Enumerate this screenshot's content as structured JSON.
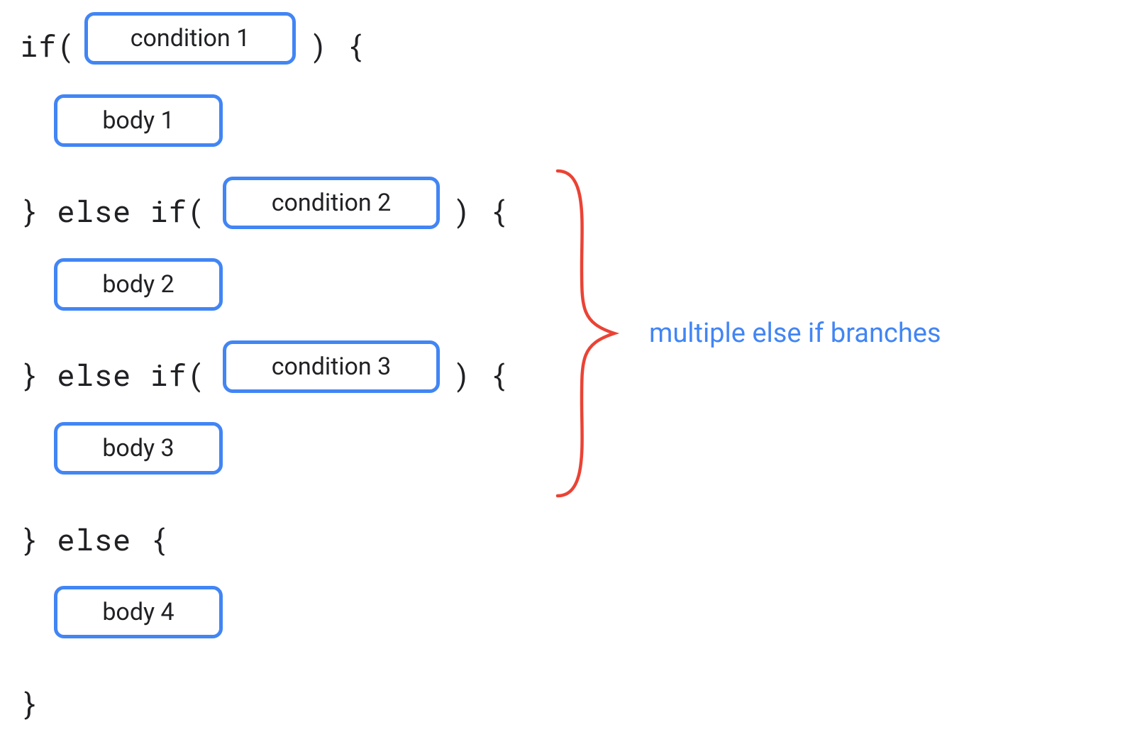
{
  "code": {
    "if_open": "if(",
    "if_close": ") {",
    "else_if_open": "} else if(",
    "else_if_close": ") {",
    "else_open": "} else {",
    "close_brace": "}"
  },
  "pills": {
    "condition1": "condition 1",
    "body1": "body 1",
    "condition2": "condition 2",
    "body2": "body 2",
    "condition3": "condition 3",
    "body3": "body 3",
    "body4": "body 4"
  },
  "annotation": "multiple else if branches",
  "colors": {
    "blue": "#4285F4",
    "red": "#EA4335",
    "text": "#202124"
  }
}
